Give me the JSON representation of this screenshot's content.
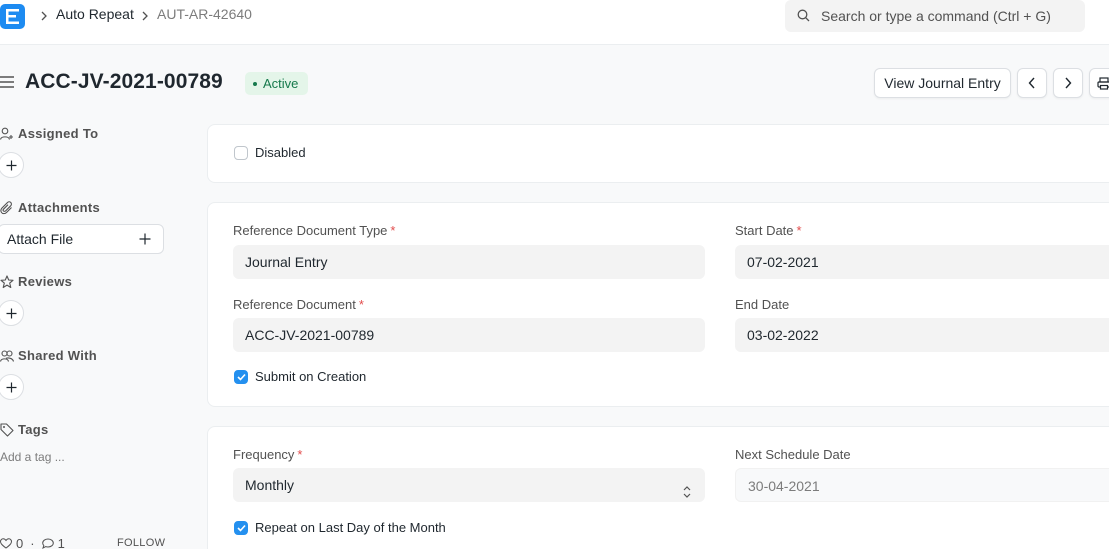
{
  "navbar": {
    "breadcrumbs": [
      "Auto Repeat",
      "AUT-AR-42640"
    ],
    "search_placeholder": "Search or type a command (Ctrl + G)"
  },
  "page": {
    "title": "ACC-JV-2021-00789",
    "status": "Active",
    "view_button": "View Journal Entry"
  },
  "sidebar": {
    "assigned_to": "Assigned To",
    "attachments": "Attachments",
    "attach_file": "Attach File",
    "reviews": "Reviews",
    "shared_with": "Shared With",
    "tags": "Tags",
    "add_tag": "Add a tag ...",
    "likes": "0",
    "comments": "1",
    "follow": "FOLLOW"
  },
  "form": {
    "disabled_label": "Disabled",
    "disabled_checked": false,
    "ref_doc_type_label": "Reference Document Type",
    "ref_doc_type_value": "Journal Entry",
    "start_date_label": "Start Date",
    "start_date_value": "07-02-2021",
    "ref_doc_label": "Reference Document",
    "ref_doc_value": "ACC-JV-2021-00789",
    "end_date_label": "End Date",
    "end_date_value": "03-02-2022",
    "submit_on_creation_label": "Submit on Creation",
    "submit_on_creation_checked": true,
    "frequency_label": "Frequency",
    "frequency_value": "Monthly",
    "next_schedule_label": "Next Schedule Date",
    "next_schedule_value": "30-04-2021",
    "repeat_last_day_label": "Repeat on Last Day of the Month",
    "repeat_last_day_checked": true
  },
  "colors": {
    "accent": "#2490ef",
    "status_bg": "#e4f5e9",
    "status_text": "#16794c",
    "required": "#e24c4c"
  }
}
